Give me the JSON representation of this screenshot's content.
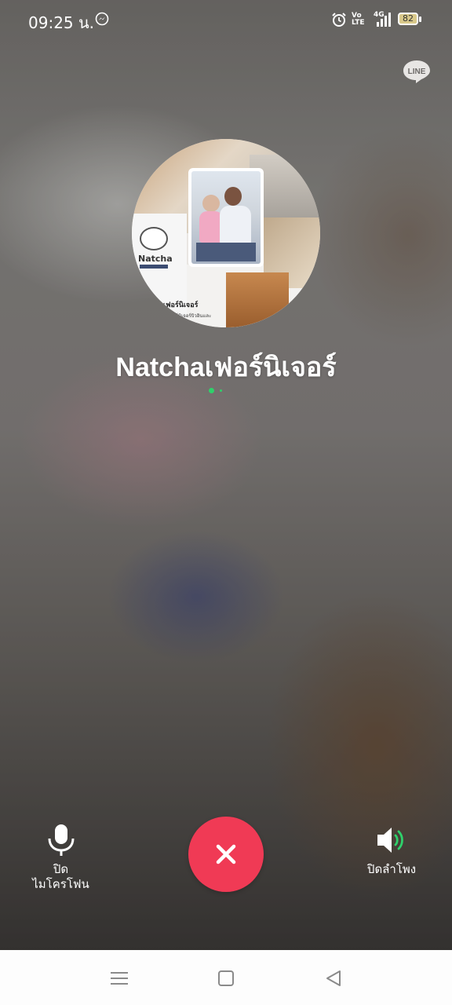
{
  "status_bar": {
    "time": "09:25 น.",
    "volte_top": "Vo",
    "volte_bottom": "LTE",
    "network": "4G",
    "battery": "82"
  },
  "app_badge": "LINE",
  "call": {
    "contact_name": "Natchaเฟอร์นิเจอร์",
    "avatar_text": {
      "logo": "Natcha",
      "caption_line1": "เฟอร์นิเจอร์",
      "caption_line2": "เฟอร์นิเจอร์บิวอินและ"
    },
    "end_call_icon": "close-icon"
  },
  "controls": {
    "mute_label_line1": "ปิด",
    "mute_label_line2": "ไมโครโฟน",
    "speaker_label": "ปิดลำโพง"
  },
  "colors": {
    "end_call": "#f03a55",
    "connecting_dots": "#2fd16b",
    "speaker_wave": "#2fd16b"
  },
  "nav": {
    "icons": [
      "menu-icon",
      "home-square-icon",
      "back-triangle-icon"
    ]
  }
}
